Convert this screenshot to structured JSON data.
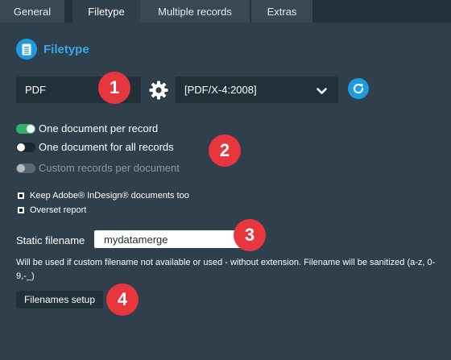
{
  "tabs": [
    {
      "label": "General",
      "active": false
    },
    {
      "label": "Filetype",
      "active": true
    },
    {
      "label": "Multiple records",
      "active": false
    },
    {
      "label": "Extras",
      "active": false
    }
  ],
  "section": {
    "title": "Filetype",
    "icon": "document-icon"
  },
  "filetype": {
    "value": "PDF"
  },
  "pdf_standard": {
    "value": "[PDF/X-4:2008]"
  },
  "toggles": [
    {
      "label": "One document per record",
      "on": true,
      "disabled": false
    },
    {
      "label": "One document for all records",
      "on": false,
      "disabled": false
    },
    {
      "label": "Custom records per document",
      "on": false,
      "disabled": true
    }
  ],
  "checkboxes": [
    {
      "label": "Keep Adobe® InDesign® documents too"
    },
    {
      "label": "Overset report"
    }
  ],
  "static_filename": {
    "label": "Static filename",
    "value": "mydatamerge"
  },
  "note": "Will be used if custom filename not available or used - without extension. Filename will be sanitized (a-z, 0-9,-_)",
  "filenames_button": {
    "label": "Filenames setup"
  },
  "badges": [
    "1",
    "2",
    "3",
    "4"
  ],
  "colors": {
    "accent": "#1e9be0",
    "badge": "#e8363f",
    "toggle_on": "#2fb36b"
  }
}
